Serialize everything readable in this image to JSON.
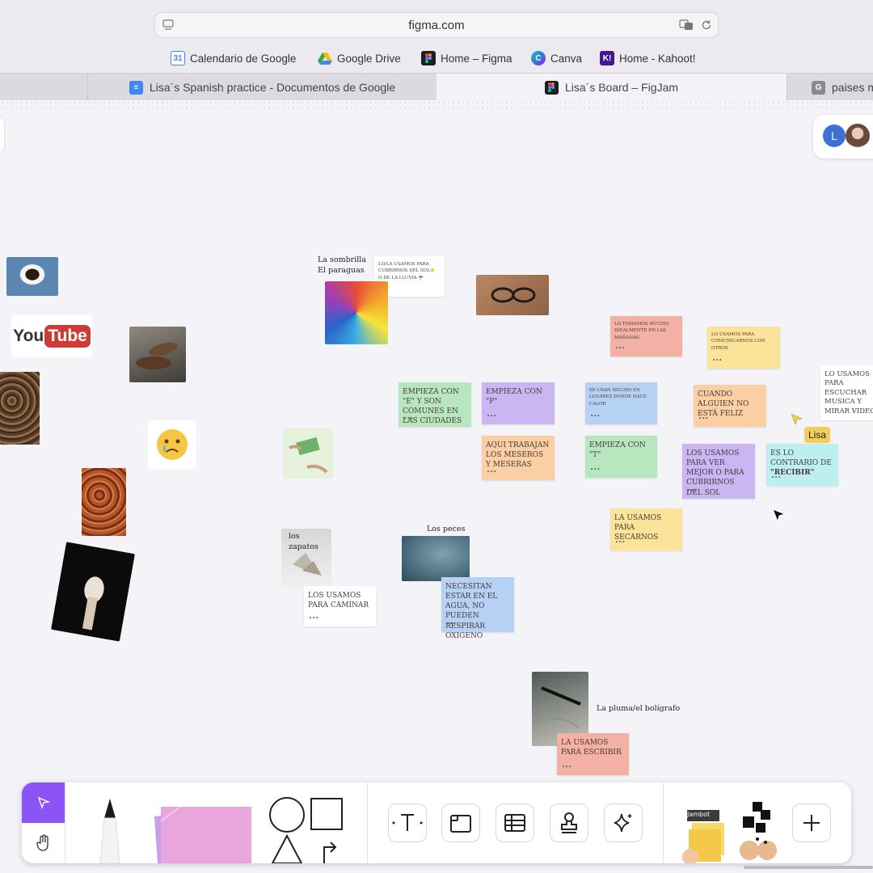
{
  "browser": {
    "url": "figma.com",
    "bookmarks": [
      {
        "label": "Calendario de Google",
        "icon": "google-calendar-icon"
      },
      {
        "label": "Google Drive",
        "icon": "google-drive-icon"
      },
      {
        "label": "Home – Figma",
        "icon": "figma-icon"
      },
      {
        "label": "Canva",
        "icon": "canva-icon"
      },
      {
        "label": "Home - Kahoot!",
        "icon": "kahoot-icon"
      }
    ],
    "tabs": [
      {
        "label": "Lisa´s Spanish practice - Documentos de Google",
        "icon": "google-docs-icon"
      },
      {
        "label": "Lisa´s Board – FigJam",
        "icon": "figma-icon",
        "active": true
      },
      {
        "label": "paises m",
        "icon": "google-icon"
      }
    ]
  },
  "collaborators": {
    "avatar_initial": "L"
  },
  "board": {
    "labels": {
      "umbrella": "La sombrilla\nEl paraguas",
      "shoes": "los zapatos",
      "fish": "Los peces",
      "pen": "La pluma/el bolígrafo"
    },
    "stickies": {
      "umbrella_note": "LO/LA USAMOS PARA CUBRIRNOS DEL SOL☀️ O DE LA LLUVIA ☔️",
      "morning": "LO TOMAMOS MUCHO, IDEALMENTE EN LAS MAÑANAS",
      "communicate": "LO USAMOS PARA COMUNICARNOS CON OTROS",
      "music": "LO USAMOS PARA ESCUCHAR MUSICA Y MIRAR VIDEOS",
      "starts_e": "EMPIEZA CON \"E\" Y SON COMUNES EN LAS CIUDADES",
      "starts_p": "EMPIEZA CON \"P\"",
      "hot_places": "SE USAN MUCHO EN LUGARES DONDE HACE CALOR",
      "not_happy": "CUANDO ALGUIEN NO ESTÁ FELIZ",
      "waiters": "AQUI TRABAJAN LOS MESEROS Y MESERAS",
      "starts_t": "EMPIEZA CON \"T\"",
      "see_better": "LOS USAMOS PARA VER MEJOR O PARA CUBRIRNOS DEL SOL",
      "opposite_prefix": "ES LO CONTRARIO DE",
      "opposite_word": "\"RECIBIR\"",
      "dry": "LA USAMOS PARA SECARNOS",
      "walk": "LOS USAMOS PARA CAMINAR",
      "water": "NECESITAN ESTAR EN EL AGUA, NO PUEDEN RESPIRAR OXIGENO",
      "write": "LA USAMOS PARA ESCRIBIR"
    },
    "images": {
      "youtube_text": "You",
      "youtube_tube": "Tube"
    }
  },
  "cursor": {
    "name": "Lisa"
  },
  "toolbar": {
    "tools": [
      "select-tool",
      "hand-tool",
      "marker",
      "sticky-note",
      "shapes",
      "text",
      "section",
      "table",
      "stamp",
      "ai-actions",
      "jambot",
      "widgets",
      "more"
    ],
    "jambot_label": "Jambot"
  },
  "colors": {
    "accent": "#8c53f5",
    "sticky_green": "#b8e6bf",
    "sticky_purple": "#c9b6f2",
    "sticky_blue": "#b5d2f5",
    "sticky_orange": "#f9cfa3",
    "sticky_red": "#f3b1a5",
    "sticky_yellow": "#fbe39a",
    "sticky_teal": "#bdeff0",
    "sticky_white": "#ffffff"
  }
}
